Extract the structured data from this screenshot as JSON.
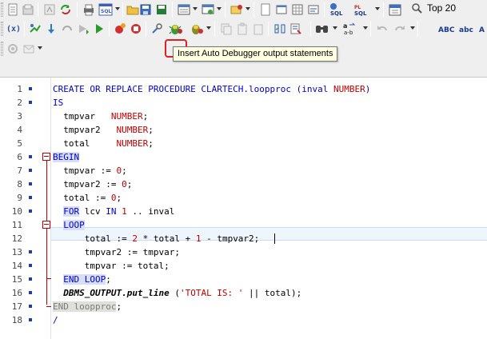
{
  "toolbar": {
    "top_combo_value": "Top 20",
    "tooltip": "Insert Auto Debugger output statements",
    "fx_label": "(x)",
    "sql_label": "SQL",
    "pl_label": "PL",
    "abc_label": "ABC",
    "abc_lower_label": "abc",
    "ab_label": "a-b"
  },
  "editor": {
    "lines": [
      {
        "num": "1"
      },
      {
        "num": "2"
      },
      {
        "num": "3"
      },
      {
        "num": "4"
      },
      {
        "num": "5"
      },
      {
        "num": "6"
      },
      {
        "num": "7"
      },
      {
        "num": "8"
      },
      {
        "num": "9"
      },
      {
        "num": "10"
      },
      {
        "num": "11"
      },
      {
        "num": "12"
      },
      {
        "num": "13"
      },
      {
        "num": "14"
      },
      {
        "num": "15"
      },
      {
        "num": "16"
      },
      {
        "num": "17"
      },
      {
        "num": "18"
      }
    ],
    "code": {
      "l1": {
        "a": "CREATE OR REPLACE PROCEDURE CLARTECH.loopproc (inval ",
        "b": "NUMBER",
        "c": ")"
      },
      "l2": {
        "a": "IS"
      },
      "l3": {
        "a": "  tmpvar   ",
        "b": "NUMBER",
        "c": ";"
      },
      "l4": {
        "a": "  tmpvar2   ",
        "b": "NUMBER",
        "c": ";"
      },
      "l5": {
        "a": "  total     ",
        "b": "NUMBER",
        "c": ";"
      },
      "l6": {
        "a": "BEGIN"
      },
      "l7": {
        "a": "  tmpvar := ",
        "b": "0",
        "c": ";"
      },
      "l8": {
        "a": "  tmpvar2 := ",
        "b": "0",
        "c": ";"
      },
      "l9": {
        "a": "  total := ",
        "b": "0",
        "c": ";"
      },
      "l10": {
        "a": "  ",
        "b": "FOR",
        "c": " lcv ",
        "d": "IN",
        "e": " ",
        "f": "1",
        "g": " .. inval"
      },
      "l11": {
        "a": "  ",
        "b": "LOOP"
      },
      "l12": {
        "a": "      total := ",
        "b": "2",
        "c": " * total + ",
        "d": "1",
        "e": " - tmpvar2;"
      },
      "l13": {
        "a": "      tmpvar2 := tmpvar;"
      },
      "l14": {
        "a": "      tmpvar := total;"
      },
      "l15": {
        "a": "  ",
        "b": "END LOOP",
        "c": ";"
      },
      "l16": {
        "a": "  ",
        "b": "DBMS_OUTPUT.put_line",
        "c": " (",
        "d": "'TOTAL IS: '",
        "e": " || total);"
      },
      "l17": {
        "a": "END loopproc",
        "b": ";"
      },
      "l18": {
        "a": "/"
      }
    }
  },
  "colors": {
    "keyword": "#0000d0",
    "type": "#c00000",
    "fold_marker": "#c00000",
    "highlight_ring": "#e02020",
    "tooltip_bg": "#ffffe1"
  }
}
